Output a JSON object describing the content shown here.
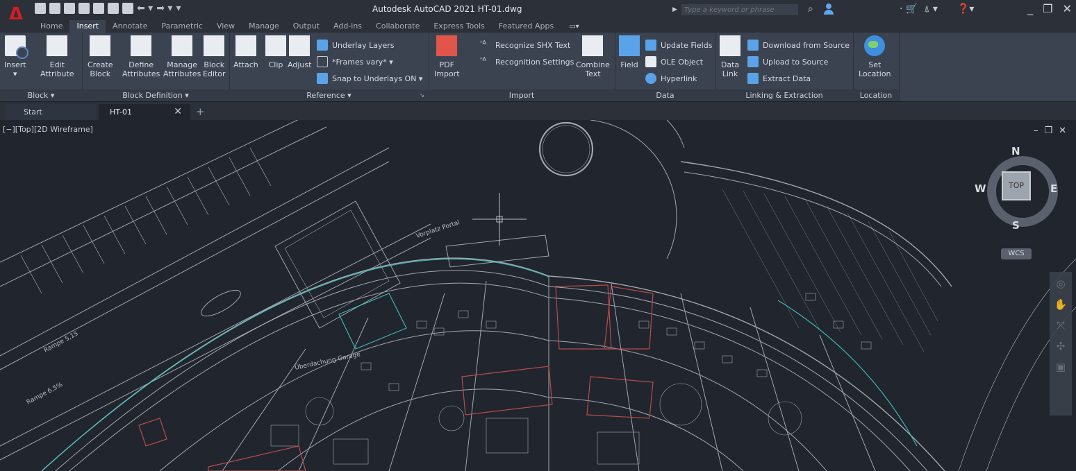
{
  "app": {
    "logo": "A",
    "window_title": "Autodesk AutoCAD 2021    HT-01.dwg"
  },
  "search": {
    "placeholder": "Type a keyword or phrase"
  },
  "ribbon_tabs": [
    "Home",
    "Insert",
    "Annotate",
    "Parametric",
    "View",
    "Manage",
    "Output",
    "Add-ins",
    "Collaborate",
    "Express Tools",
    "Featured Apps"
  ],
  "active_tab": "Insert",
  "panels": {
    "block": {
      "footer": "Block ▾",
      "insert": "Insert",
      "edit_attr_1": "Edit",
      "edit_attr_2": "Attribute"
    },
    "block_definition": {
      "footer": "Block Definition ▾",
      "create_1": "Create",
      "create_2": "Block",
      "define_1": "Define",
      "define_2": "Attributes",
      "manage_1": "Manage",
      "manage_2": "Attributes",
      "editor_1": "Block",
      "editor_2": "Editor"
    },
    "reference": {
      "footer": "Reference ▾",
      "attach": "Attach",
      "clip": "Clip",
      "adjust": "Adjust",
      "underlay_layers": "Underlay Layers",
      "frames": "*Frames vary* ▾",
      "snap": "Snap to Underlays ON ▾"
    },
    "import": {
      "footer": "Import",
      "pdf_1": "PDF",
      "pdf_2": "Import",
      "recognize_shx": "Recognize SHX Text",
      "recognition_settings": "Recognition Settings",
      "combine_1": "Combine",
      "combine_2": "Text"
    },
    "data": {
      "footer": "Data",
      "field": "Field",
      "update_fields": "Update Fields",
      "ole_object": "OLE Object",
      "hyperlink": "Hyperlink"
    },
    "linking": {
      "footer": "Linking & Extraction",
      "data_link_1": "Data",
      "data_link_2": "Link",
      "download": "Download from Source",
      "upload": "Upload to Source",
      "extract": "Extract  Data"
    },
    "location": {
      "footer": "Location",
      "set_1": "Set",
      "set_2": "Location"
    }
  },
  "doc_tabs": {
    "start": "Start",
    "current": "HT-01"
  },
  "viewport": {
    "label": "[−][Top][2D Wireframe]",
    "viewcube": {
      "north": "N",
      "south": "S",
      "east": "E",
      "west": "W",
      "face": "TOP"
    },
    "wcs": "WCS"
  },
  "drawing_labels": {
    "street": "Überdachung Garage",
    "street2": "Rampe 6,5%",
    "street3": "Rampe 5,15",
    "street4": "Vorplatz Portal"
  },
  "colors": {
    "canvas": "#21252d",
    "ribbon": "#3b4350",
    "accent_red": "#d51d24",
    "drawing_line": "#c9ced6",
    "drawing_cyan": "#3fc7c0",
    "drawing_red": "#c8514f"
  }
}
